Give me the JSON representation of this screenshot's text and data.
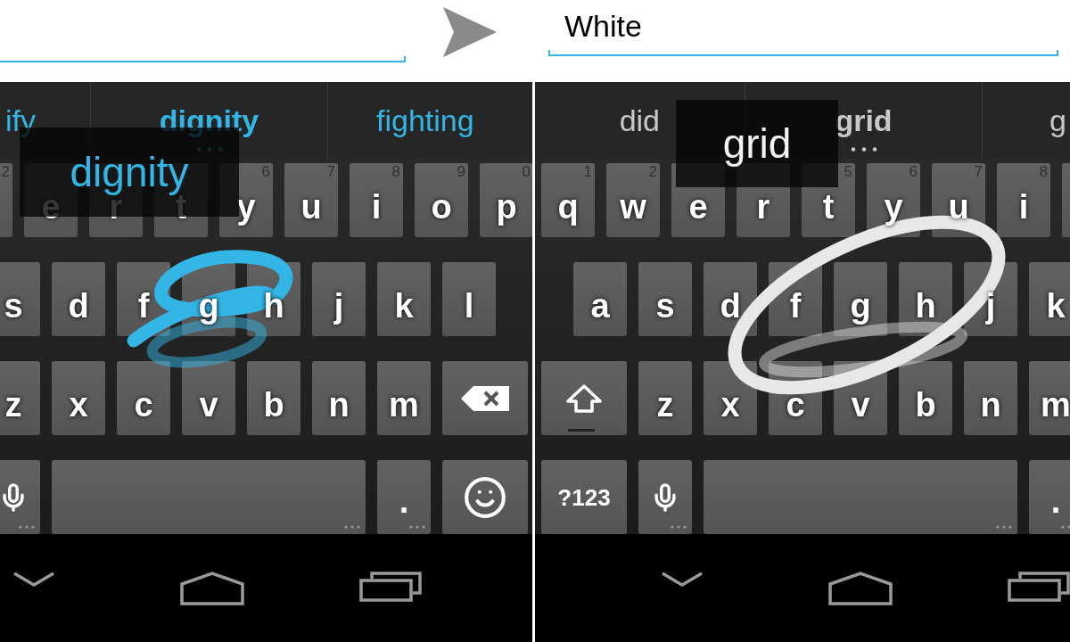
{
  "text_fields": [
    {
      "focused": true
    },
    {
      "value": "White",
      "focused": true
    }
  ],
  "keyboards": [
    {
      "kind": "holo",
      "color": "#33b5e5",
      "preview": "dignity",
      "suggestions": [
        {
          "text": "ify",
          "selected": false
        },
        {
          "text": "dignity",
          "selected": true
        },
        {
          "text": "fighting",
          "selected": false
        }
      ],
      "rows": [
        {
          "keys": [
            {
              "kind": "letter",
              "hint": "2"
            },
            {
              "kind": "letter",
              "label": "e"
            },
            {
              "kind": "letter",
              "label": "r"
            },
            {
              "kind": "letter",
              "label": "t"
            },
            {
              "kind": "letter",
              "label": "y",
              "hint": "6"
            },
            {
              "kind": "letter",
              "label": "u",
              "hint": "7"
            },
            {
              "kind": "letter",
              "label": "i",
              "hint": "8"
            },
            {
              "kind": "letter",
              "label": "o",
              "hint": "9"
            },
            {
              "kind": "letter",
              "label": "p",
              "hint": "0"
            }
          ]
        },
        {
          "keys": [
            {
              "kind": "letter",
              "label": "s"
            },
            {
              "kind": "letter",
              "label": "d"
            },
            {
              "kind": "letter",
              "label": "f"
            },
            {
              "kind": "letter",
              "label": "g"
            },
            {
              "kind": "letter",
              "label": "h"
            },
            {
              "kind": "letter",
              "label": "j"
            },
            {
              "kind": "letter",
              "label": "k"
            },
            {
              "kind": "letter",
              "label": "l"
            }
          ]
        },
        {
          "keys": [
            {
              "kind": "letter",
              "label": "z"
            },
            {
              "kind": "letter",
              "label": "x"
            },
            {
              "kind": "letter",
              "label": "c"
            },
            {
              "kind": "letter",
              "label": "v"
            },
            {
              "kind": "letter",
              "label": "b"
            },
            {
              "kind": "letter",
              "label": "n"
            },
            {
              "kind": "letter",
              "label": "m"
            },
            {
              "kind": "backspace"
            }
          ]
        },
        {
          "keys": [
            {
              "kind": "mic"
            },
            {
              "kind": "space"
            },
            {
              "kind": "period",
              "label": "."
            },
            {
              "kind": "emoji"
            }
          ]
        }
      ]
    },
    {
      "kind": "gray",
      "color": "#e8e8e8",
      "preview": "grid",
      "suggestions": [
        {
          "text": "did",
          "selected": false
        },
        {
          "text": "grid",
          "selected": true
        },
        {
          "text": "g",
          "selected": false
        }
      ],
      "rows": [
        {
          "keys": [
            {
              "kind": "letter",
              "label": "q",
              "hint": "1"
            },
            {
              "kind": "letter",
              "label": "w",
              "hint": "2"
            },
            {
              "kind": "letter",
              "label": "e"
            },
            {
              "kind": "letter",
              "label": "r"
            },
            {
              "kind": "letter",
              "label": "t",
              "hint": "5"
            },
            {
              "kind": "letter",
              "label": "y",
              "hint": "6"
            },
            {
              "kind": "letter",
              "label": "u",
              "hint": "7"
            },
            {
              "kind": "letter",
              "label": "i",
              "hint": "8"
            },
            {
              "kind": "letter"
            }
          ]
        },
        {
          "keys": [
            {
              "kind": "letter",
              "label": "a"
            },
            {
              "kind": "letter",
              "label": "s"
            },
            {
              "kind": "letter",
              "label": "d"
            },
            {
              "kind": "letter",
              "label": "f"
            },
            {
              "kind": "letter",
              "label": "g"
            },
            {
              "kind": "letter",
              "label": "h"
            },
            {
              "kind": "letter",
              "label": "j"
            },
            {
              "kind": "letter",
              "label": "k"
            }
          ]
        },
        {
          "keys": [
            {
              "kind": "shift"
            },
            {
              "kind": "letter",
              "label": "z"
            },
            {
              "kind": "letter",
              "label": "x"
            },
            {
              "kind": "letter",
              "label": "c"
            },
            {
              "kind": "letter",
              "label": "v"
            },
            {
              "kind": "letter",
              "label": "b"
            },
            {
              "kind": "letter",
              "label": "n"
            },
            {
              "kind": "letter",
              "label": "m"
            }
          ]
        },
        {
          "keys": [
            {
              "kind": "symbols",
              "label": "?123"
            },
            {
              "kind": "mic"
            },
            {
              "kind": "space"
            },
            {
              "kind": "period",
              "label": "."
            }
          ]
        }
      ]
    }
  ]
}
